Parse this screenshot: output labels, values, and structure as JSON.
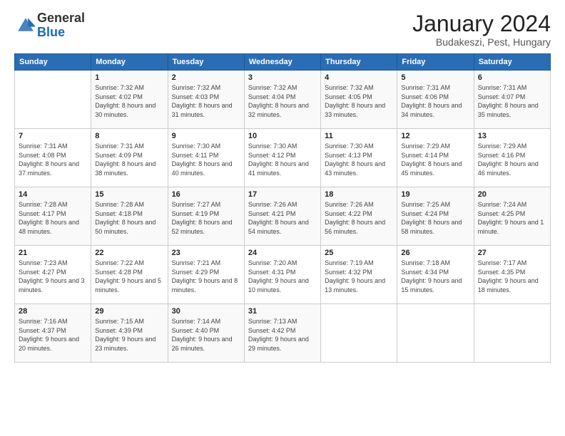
{
  "logo": {
    "general": "General",
    "blue": "Blue"
  },
  "header": {
    "month": "January 2024",
    "location": "Budakeszi, Pest, Hungary"
  },
  "weekdays": [
    "Sunday",
    "Monday",
    "Tuesday",
    "Wednesday",
    "Thursday",
    "Friday",
    "Saturday"
  ],
  "weeks": [
    [
      {
        "day": "",
        "sunrise": "",
        "sunset": "",
        "daylight": ""
      },
      {
        "day": "1",
        "sunrise": "Sunrise: 7:32 AM",
        "sunset": "Sunset: 4:02 PM",
        "daylight": "Daylight: 8 hours and 30 minutes."
      },
      {
        "day": "2",
        "sunrise": "Sunrise: 7:32 AM",
        "sunset": "Sunset: 4:03 PM",
        "daylight": "Daylight: 8 hours and 31 minutes."
      },
      {
        "day": "3",
        "sunrise": "Sunrise: 7:32 AM",
        "sunset": "Sunset: 4:04 PM",
        "daylight": "Daylight: 8 hours and 32 minutes."
      },
      {
        "day": "4",
        "sunrise": "Sunrise: 7:32 AM",
        "sunset": "Sunset: 4:05 PM",
        "daylight": "Daylight: 8 hours and 33 minutes."
      },
      {
        "day": "5",
        "sunrise": "Sunrise: 7:31 AM",
        "sunset": "Sunset: 4:06 PM",
        "daylight": "Daylight: 8 hours and 34 minutes."
      },
      {
        "day": "6",
        "sunrise": "Sunrise: 7:31 AM",
        "sunset": "Sunset: 4:07 PM",
        "daylight": "Daylight: 8 hours and 35 minutes."
      }
    ],
    [
      {
        "day": "7",
        "sunrise": "Sunrise: 7:31 AM",
        "sunset": "Sunset: 4:08 PM",
        "daylight": "Daylight: 8 hours and 37 minutes."
      },
      {
        "day": "8",
        "sunrise": "Sunrise: 7:31 AM",
        "sunset": "Sunset: 4:09 PM",
        "daylight": "Daylight: 8 hours and 38 minutes."
      },
      {
        "day": "9",
        "sunrise": "Sunrise: 7:30 AM",
        "sunset": "Sunset: 4:11 PM",
        "daylight": "Daylight: 8 hours and 40 minutes."
      },
      {
        "day": "10",
        "sunrise": "Sunrise: 7:30 AM",
        "sunset": "Sunset: 4:12 PM",
        "daylight": "Daylight: 8 hours and 41 minutes."
      },
      {
        "day": "11",
        "sunrise": "Sunrise: 7:30 AM",
        "sunset": "Sunset: 4:13 PM",
        "daylight": "Daylight: 8 hours and 43 minutes."
      },
      {
        "day": "12",
        "sunrise": "Sunrise: 7:29 AM",
        "sunset": "Sunset: 4:14 PM",
        "daylight": "Daylight: 8 hours and 45 minutes."
      },
      {
        "day": "13",
        "sunrise": "Sunrise: 7:29 AM",
        "sunset": "Sunset: 4:16 PM",
        "daylight": "Daylight: 8 hours and 46 minutes."
      }
    ],
    [
      {
        "day": "14",
        "sunrise": "Sunrise: 7:28 AM",
        "sunset": "Sunset: 4:17 PM",
        "daylight": "Daylight: 8 hours and 48 minutes."
      },
      {
        "day": "15",
        "sunrise": "Sunrise: 7:28 AM",
        "sunset": "Sunset: 4:18 PM",
        "daylight": "Daylight: 8 hours and 50 minutes."
      },
      {
        "day": "16",
        "sunrise": "Sunrise: 7:27 AM",
        "sunset": "Sunset: 4:19 PM",
        "daylight": "Daylight: 8 hours and 52 minutes."
      },
      {
        "day": "17",
        "sunrise": "Sunrise: 7:26 AM",
        "sunset": "Sunset: 4:21 PM",
        "daylight": "Daylight: 8 hours and 54 minutes."
      },
      {
        "day": "18",
        "sunrise": "Sunrise: 7:26 AM",
        "sunset": "Sunset: 4:22 PM",
        "daylight": "Daylight: 8 hours and 56 minutes."
      },
      {
        "day": "19",
        "sunrise": "Sunrise: 7:25 AM",
        "sunset": "Sunset: 4:24 PM",
        "daylight": "Daylight: 8 hours and 58 minutes."
      },
      {
        "day": "20",
        "sunrise": "Sunrise: 7:24 AM",
        "sunset": "Sunset: 4:25 PM",
        "daylight": "Daylight: 9 hours and 1 minute."
      }
    ],
    [
      {
        "day": "21",
        "sunrise": "Sunrise: 7:23 AM",
        "sunset": "Sunset: 4:27 PM",
        "daylight": "Daylight: 9 hours and 3 minutes."
      },
      {
        "day": "22",
        "sunrise": "Sunrise: 7:22 AM",
        "sunset": "Sunset: 4:28 PM",
        "daylight": "Daylight: 9 hours and 5 minutes."
      },
      {
        "day": "23",
        "sunrise": "Sunrise: 7:21 AM",
        "sunset": "Sunset: 4:29 PM",
        "daylight": "Daylight: 9 hours and 8 minutes."
      },
      {
        "day": "24",
        "sunrise": "Sunrise: 7:20 AM",
        "sunset": "Sunset: 4:31 PM",
        "daylight": "Daylight: 9 hours and 10 minutes."
      },
      {
        "day": "25",
        "sunrise": "Sunrise: 7:19 AM",
        "sunset": "Sunset: 4:32 PM",
        "daylight": "Daylight: 9 hours and 13 minutes."
      },
      {
        "day": "26",
        "sunrise": "Sunrise: 7:18 AM",
        "sunset": "Sunset: 4:34 PM",
        "daylight": "Daylight: 9 hours and 15 minutes."
      },
      {
        "day": "27",
        "sunrise": "Sunrise: 7:17 AM",
        "sunset": "Sunset: 4:35 PM",
        "daylight": "Daylight: 9 hours and 18 minutes."
      }
    ],
    [
      {
        "day": "28",
        "sunrise": "Sunrise: 7:16 AM",
        "sunset": "Sunset: 4:37 PM",
        "daylight": "Daylight: 9 hours and 20 minutes."
      },
      {
        "day": "29",
        "sunrise": "Sunrise: 7:15 AM",
        "sunset": "Sunset: 4:39 PM",
        "daylight": "Daylight: 9 hours and 23 minutes."
      },
      {
        "day": "30",
        "sunrise": "Sunrise: 7:14 AM",
        "sunset": "Sunset: 4:40 PM",
        "daylight": "Daylight: 9 hours and 26 minutes."
      },
      {
        "day": "31",
        "sunrise": "Sunrise: 7:13 AM",
        "sunset": "Sunset: 4:42 PM",
        "daylight": "Daylight: 9 hours and 29 minutes."
      },
      {
        "day": "",
        "sunrise": "",
        "sunset": "",
        "daylight": ""
      },
      {
        "day": "",
        "sunrise": "",
        "sunset": "",
        "daylight": ""
      },
      {
        "day": "",
        "sunrise": "",
        "sunset": "",
        "daylight": ""
      }
    ]
  ]
}
